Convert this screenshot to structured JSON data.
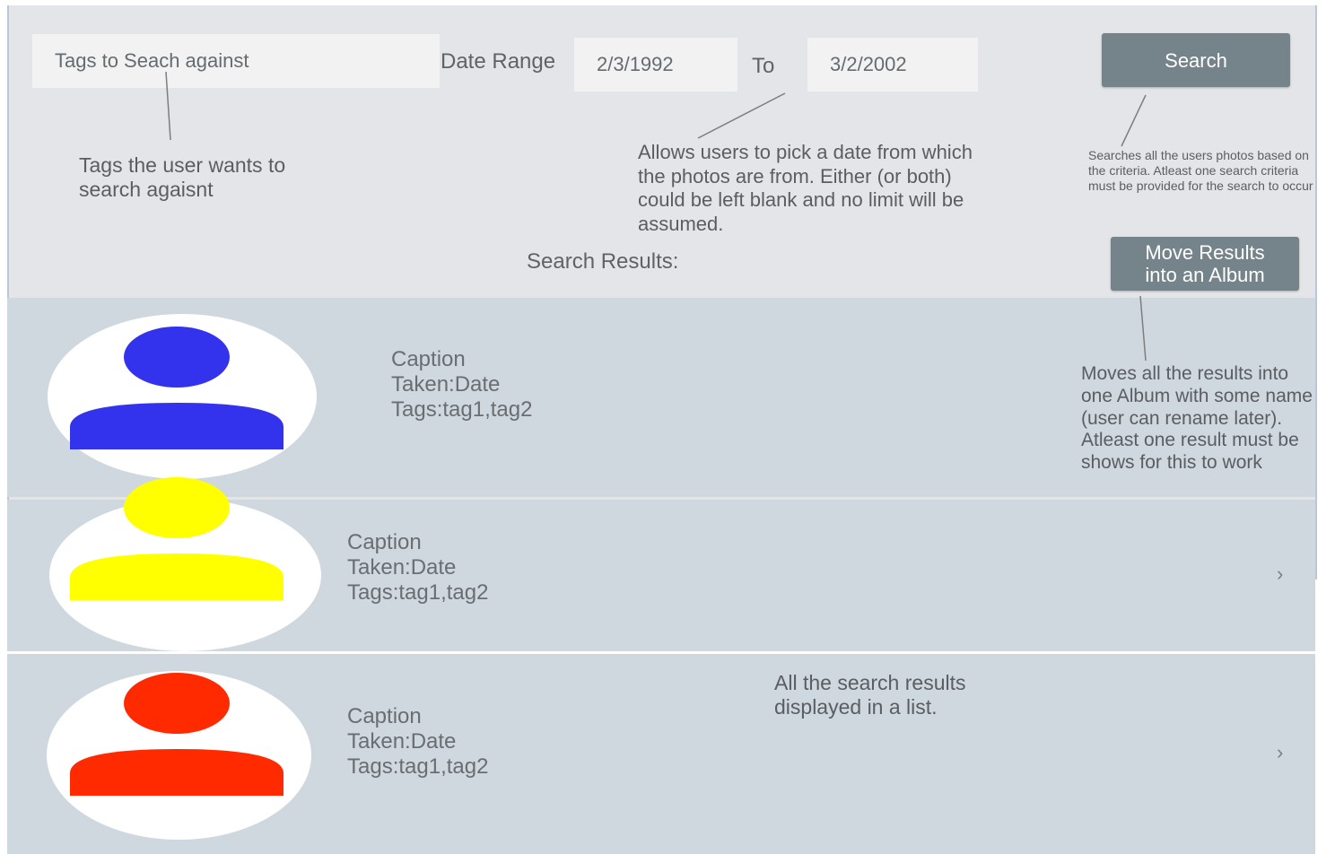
{
  "search_bar": {
    "tags_placeholder": "Tags to Seach against",
    "date_range_label": "Date Range",
    "date_from": "2/3/1992",
    "to_label": "To",
    "date_to": "3/2/2002",
    "search_button": "Search"
  },
  "annotations": {
    "tags_note": "Tags the user wants to search agaisnt",
    "date_note": "Allows users to pick a date from which the photos are from. Either (or both) could be left blank and no limit will be assumed.",
    "search_note": "Searches all the users photos based on the criteria. Atleast one search criteria must be provided for the search to occur",
    "move_note": "Moves all the results into one Album with some name (user can rename later). Atleast one result must be shows for this to work",
    "list_note": "All the search results displayed in a list."
  },
  "results_header": "Search Results:",
  "move_button": {
    "line1": "Move Results",
    "line2": "into an Album"
  },
  "results": [
    {
      "caption": "Caption",
      "taken": "Taken:Date",
      "tags": "Tags:tag1,tag2",
      "avatar_color": "#3333ee"
    },
    {
      "caption": "Caption",
      "taken": "Taken:Date",
      "tags": "Tags:tag1,tag2",
      "avatar_color": "#ffff00"
    },
    {
      "caption": "Caption",
      "taken": "Taken:Date",
      "tags": "Tags:tag1,tag2",
      "avatar_color": "#ff2a00"
    }
  ],
  "chevron": "›",
  "colors": {
    "button": "#75848b",
    "row": "#cfd8de",
    "panel": "#e4e5e8"
  }
}
